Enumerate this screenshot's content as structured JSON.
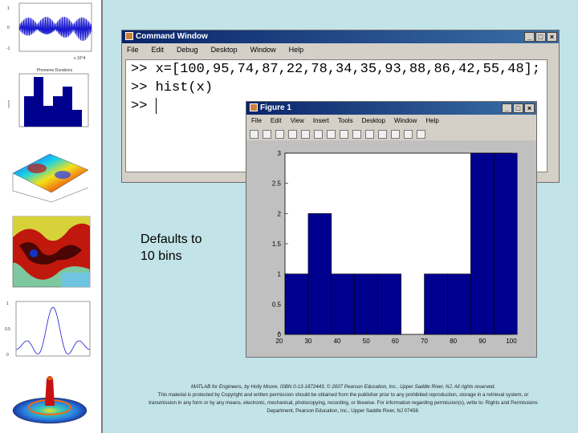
{
  "thumbnails": [
    {
      "name": "audio-waveform-thumbnail",
      "axis_label": "x 10^4"
    },
    {
      "name": "histogram-thumbnail",
      "title": "Phoneme Durations"
    },
    {
      "name": "surface-plot-thumbnail"
    },
    {
      "name": "fractal-image-thumbnail"
    },
    {
      "name": "sinc-line-plot-thumbnail"
    },
    {
      "name": "3d-sombrero-thumbnail"
    }
  ],
  "command_window": {
    "title": "Command Window",
    "menu": [
      "File",
      "Edit",
      "Debug",
      "Desktop",
      "Window",
      "Help"
    ],
    "lines": [
      ">> x=[100,95,74,87,22,78,34,35,93,88,86,42,55,48];",
      ">> hist(x)",
      ">> "
    ]
  },
  "figure_window": {
    "title": "Figure 1",
    "menu": [
      "File",
      "Edit",
      "View",
      "Insert",
      "Tools",
      "Desktop",
      "Window",
      "Help"
    ]
  },
  "chart_data": {
    "type": "bar",
    "bin_edges": [
      20,
      30,
      40,
      50,
      60,
      70,
      80,
      90,
      100
    ],
    "bin_centers": [
      26,
      34,
      42,
      50,
      58,
      66,
      74,
      82,
      90,
      98
    ],
    "values": [
      1,
      2,
      1,
      1,
      1,
      0,
      1,
      1,
      3,
      3
    ],
    "x_ticks": [
      "20",
      "30",
      "40",
      "50",
      "60",
      "70",
      "80",
      "90",
      "100"
    ],
    "y_ticks": [
      "0",
      "0.5",
      "1",
      "1.5",
      "2",
      "2.5",
      "3"
    ],
    "xlim": [
      22,
      100
    ],
    "ylim": [
      0,
      3
    ],
    "bar_color": "#00008f"
  },
  "caption": {
    "line1": "Defaults to",
    "line2": "10 bins"
  },
  "copyright": {
    "line1": "MATLAB for Engineers, by Holly Moore. ISBN 0-13-1872443. © 2007 Pearson Education, Inc., Upper Saddle River, NJ. All rights reserved.",
    "line2": "This material is protected by Copyright and written permission should be obtained from the publisher prior to any prohibited reproduction, storage in a retrieval system, or transmission in any form or by any means, electronic, mechanical, photocopying, recording, or likewise. For information regarding permission(s), write to: Rights and Permissions Department, Pearson Education, Inc., Upper Saddle River, NJ 07458."
  }
}
